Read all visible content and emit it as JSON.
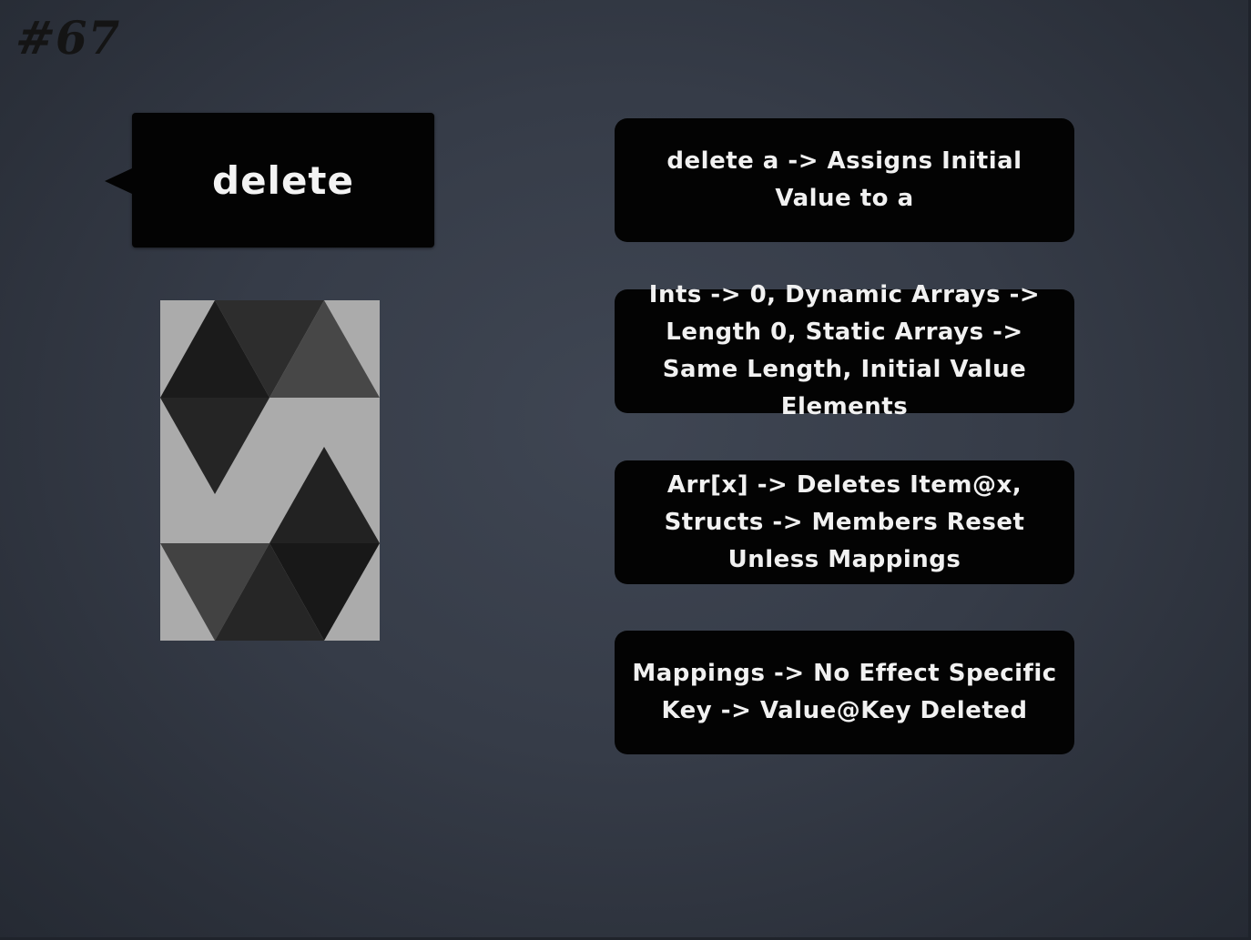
{
  "slide": {
    "number": "#67",
    "title": "delete"
  },
  "logo": {
    "icon": "solidity-logo-icon",
    "background": "#ababab"
  },
  "cards": [
    {
      "text": "delete a -> Assigns Initial Value to a"
    },
    {
      "text": "Ints -> 0, Dynamic Arrays -> Length 0, Static Arrays -> Same Length, Initial Value Elements"
    },
    {
      "text": "Arr[x] -> Deletes Item@x, Structs -> Members Reset Unless Mappings"
    },
    {
      "text": "Mappings -> No Effect Specific Key -> Value@Key Deleted"
    }
  ],
  "colors": {
    "background": "#363c48",
    "card": "#030303",
    "text": "#f1f1f1"
  }
}
